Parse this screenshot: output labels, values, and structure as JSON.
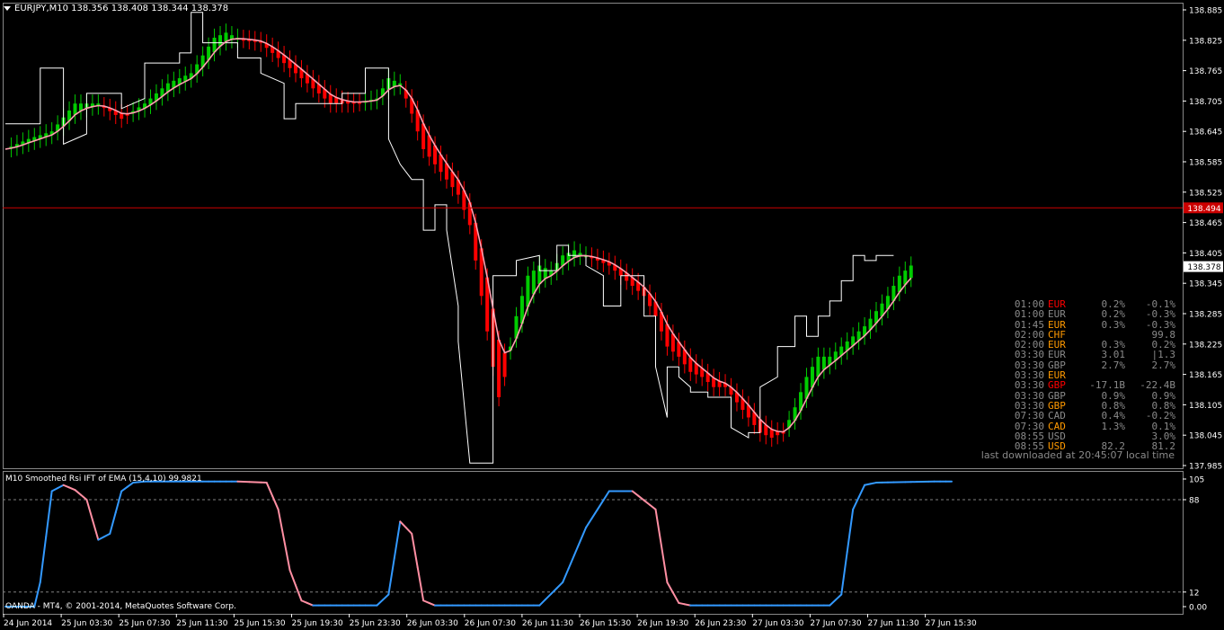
{
  "symbol_header": "EURJPY,M10  138.356 138.408 138.344 138.378",
  "indicator_title": "M10 Smoothed Rsi IFT of EMA (15,4,10) 99.9821",
  "copyright": "OANDA - MT4, © 2001-2014, MetaQuotes Software Corp.",
  "last_downloaded": "last downloaded at 20:45:07 local time",
  "colors": {
    "background": "#000000",
    "up_bar": "#00cc00",
    "down_bar": "#ff0000",
    "ema_line": "#ff9fb0",
    "channel_line": "#ffffff",
    "rsi_up": "#3399ff",
    "rsi_down": "#ff8fa3",
    "hline": "#cc0000",
    "grid": "#808080"
  },
  "news": [
    {
      "time": "01:00",
      "cur": "EUR",
      "color": "#ff0000",
      "a": "0.2%",
      "b": "-0.1%"
    },
    {
      "time": "01:00",
      "cur": "EUR",
      "color": "#8a8a8a",
      "a": "0.2%",
      "b": "-0.3%"
    },
    {
      "time": "01:45",
      "cur": "EUR",
      "color": "#ff9900",
      "a": "0.3%",
      "b": "-0.3%"
    },
    {
      "time": "02:00",
      "cur": "CHF",
      "color": "#ff9900",
      "a": "",
      "b": "99.8"
    },
    {
      "time": "02:00",
      "cur": "EUR",
      "color": "#ff9900",
      "a": "0.3%",
      "b": "0.2%"
    },
    {
      "time": "03:30",
      "cur": "EUR",
      "color": "#8a8a8a",
      "a": "3.01",
      "b": "|1.3"
    },
    {
      "time": "03:30",
      "cur": "GBP",
      "color": "#8a8a8a",
      "a": "2.7%",
      "b": "2.7%"
    },
    {
      "time": "03:30",
      "cur": "EUR",
      "color": "#ff9900",
      "a": "",
      "b": ""
    },
    {
      "time": "03:30",
      "cur": "GBP",
      "color": "#ff0000",
      "a": "-17.1B",
      "b": "-22.4B"
    },
    {
      "time": "03:30",
      "cur": "GBP",
      "color": "#8a8a8a",
      "a": "0.9%",
      "b": "0.9%"
    },
    {
      "time": "03:30",
      "cur": "GBP",
      "color": "#ff9900",
      "a": "0.8%",
      "b": "0.8%"
    },
    {
      "time": "07:30",
      "cur": "CAD",
      "color": "#8a8a8a",
      "a": "0.4%",
      "b": "-0.2%"
    },
    {
      "time": "07:30",
      "cur": "CAD",
      "color": "#ff9900",
      "a": "1.3%",
      "b": "0.1%"
    },
    {
      "time": "08:55",
      "cur": "USD",
      "color": "#8a8a8a",
      "a": "",
      "b": "3.0%"
    },
    {
      "time": "08:55",
      "cur": "USD",
      "color": "#ff9900",
      "a": "82.2",
      "b": "81.2"
    }
  ],
  "chart_data": [
    {
      "type": "candlestick",
      "title": "EURJPY,M10",
      "x_ticks": [
        "24 Jun 2014",
        "25 Jun 03:30",
        "25 Jun 07:30",
        "25 Jun 11:30",
        "25 Jun 15:30",
        "25 Jun 19:30",
        "25 Jun 23:30",
        "26 Jun 03:30",
        "26 Jun 07:30",
        "26 Jun 11:30",
        "26 Jun 15:30",
        "26 Jun 19:30",
        "26 Jun 23:30",
        "27 Jun 03:30",
        "27 Jun 07:30",
        "27 Jun 11:30",
        "27 Jun 15:30"
      ],
      "y_ticks": [
        "138.885",
        "138.825",
        "138.765",
        "138.705",
        "138.645",
        "138.585",
        "138.525",
        "138.465",
        "138.405",
        "138.345",
        "138.285",
        "138.225",
        "138.165",
        "138.105",
        "138.045",
        "137.985"
      ],
      "ylim": [
        137.985,
        138.885
      ],
      "grid": false,
      "hline": {
        "label": "138.494",
        "value": 138.494
      },
      "current_price": {
        "label": "138.378",
        "value": 138.378
      },
      "series": [
        {
          "name": "price",
          "anchors": [
            [
              0,
              138.61
            ],
            [
              4,
              138.63
            ],
            [
              8,
              138.645
            ],
            [
              12,
              138.7
            ],
            [
              16,
              138.7
            ],
            [
              20,
              138.67
            ],
            [
              24,
              138.7
            ],
            [
              28,
              138.74
            ],
            [
              32,
              138.76
            ],
            [
              36,
              138.83
            ],
            [
              38,
              138.84
            ],
            [
              40,
              138.83
            ],
            [
              44,
              138.82
            ],
            [
              48,
              138.78
            ],
            [
              52,
              138.74
            ],
            [
              56,
              138.7
            ],
            [
              60,
              138.7
            ],
            [
              64,
              138.71
            ],
            [
              66,
              138.75
            ],
            [
              68,
              138.74
            ],
            [
              70,
              138.68
            ],
            [
              72,
              138.61
            ],
            [
              74,
              138.58
            ],
            [
              76,
              138.55
            ],
            [
              78,
              138.52
            ],
            [
              80,
              138.46
            ],
            [
              82,
              138.32
            ],
            [
              84,
              138.18
            ],
            [
              85,
              138.12
            ],
            [
              86,
              138.16
            ],
            [
              88,
              138.28
            ],
            [
              90,
              138.36
            ],
            [
              92,
              138.38
            ],
            [
              94,
              138.37
            ],
            [
              96,
              138.4
            ],
            [
              98,
              138.41
            ],
            [
              100,
              138.4
            ],
            [
              102,
              138.39
            ],
            [
              104,
              138.38
            ],
            [
              106,
              138.36
            ],
            [
              108,
              138.34
            ],
            [
              110,
              138.32
            ],
            [
              112,
              138.28
            ],
            [
              114,
              138.22
            ],
            [
              116,
              138.2
            ],
            [
              118,
              138.17
            ],
            [
              120,
              138.16
            ],
            [
              122,
              138.14
            ],
            [
              124,
              138.14
            ],
            [
              126,
              138.11
            ],
            [
              128,
              138.08
            ],
            [
              130,
              138.05
            ],
            [
              132,
              138.04
            ],
            [
              134,
              138.05
            ],
            [
              136,
              138.1
            ],
            [
              138,
              138.16
            ],
            [
              140,
              138.2
            ],
            [
              142,
              138.2
            ],
            [
              144,
              138.22
            ],
            [
              146,
              138.24
            ],
            [
              148,
              138.26
            ],
            [
              150,
              138.29
            ],
            [
              152,
              138.32
            ],
            [
              154,
              138.36
            ],
            [
              156,
              138.38
            ]
          ]
        },
        {
          "name": "channel",
          "anchors": [
            [
              0,
              138.66
            ],
            [
              6,
              138.66
            ],
            [
              6,
              138.77
            ],
            [
              10,
              138.77
            ],
            [
              10,
              138.62
            ],
            [
              14,
              138.64
            ],
            [
              14,
              138.72
            ],
            [
              20,
              138.72
            ],
            [
              20,
              138.69
            ],
            [
              24,
              138.71
            ],
            [
              24,
              138.78
            ],
            [
              30,
              138.78
            ],
            [
              30,
              138.8
            ],
            [
              32,
              138.8
            ],
            [
              32,
              138.88
            ],
            [
              34,
              138.88
            ],
            [
              34,
              138.82
            ],
            [
              40,
              138.82
            ],
            [
              40,
              138.79
            ],
            [
              44,
              138.79
            ],
            [
              44,
              138.76
            ],
            [
              48,
              138.74
            ],
            [
              48,
              138.67
            ],
            [
              50,
              138.67
            ],
            [
              50,
              138.7
            ],
            [
              58,
              138.7
            ],
            [
              58,
              138.72
            ],
            [
              62,
              138.72
            ],
            [
              62,
              138.77
            ],
            [
              66,
              138.77
            ],
            [
              66,
              138.63
            ],
            [
              68,
              138.58
            ],
            [
              70,
              138.55
            ],
            [
              72,
              138.55
            ],
            [
              72,
              138.45
            ],
            [
              74,
              138.45
            ],
            [
              74,
              138.5
            ],
            [
              76,
              138.5
            ],
            [
              76,
              138.45
            ],
            [
              78,
              138.3
            ],
            [
              78,
              138.23
            ],
            [
              80,
              137.99
            ],
            [
              84,
              137.99
            ],
            [
              84,
              138.36
            ],
            [
              88,
              138.36
            ],
            [
              88,
              138.39
            ],
            [
              92,
              138.4
            ],
            [
              92,
              138.37
            ],
            [
              95,
              138.37
            ],
            [
              95,
              138.42
            ],
            [
              97,
              138.42
            ],
            [
              97,
              138.4
            ],
            [
              100,
              138.4
            ],
            [
              100,
              138.38
            ],
            [
              103,
              138.36
            ],
            [
              103,
              138.3
            ],
            [
              106,
              138.3
            ],
            [
              106,
              138.36
            ],
            [
              110,
              138.36
            ],
            [
              110,
              138.28
            ],
            [
              112,
              138.28
            ],
            [
              112,
              138.18
            ],
            [
              114,
              138.08
            ],
            [
              114,
              138.18
            ],
            [
              116,
              138.18
            ],
            [
              116,
              138.16
            ],
            [
              118,
              138.14
            ],
            [
              118,
              138.13
            ],
            [
              121,
              138.13
            ],
            [
              121,
              138.12
            ],
            [
              125,
              138.12
            ],
            [
              125,
              138.06
            ],
            [
              128,
              138.04
            ],
            [
              128,
              138.05
            ],
            [
              130,
              138.05
            ],
            [
              130,
              138.14
            ],
            [
              133,
              138.16
            ],
            [
              133,
              138.22
            ],
            [
              136,
              138.22
            ],
            [
              136,
              138.28
            ],
            [
              138,
              138.28
            ],
            [
              138,
              138.24
            ],
            [
              140,
              138.24
            ],
            [
              140,
              138.28
            ],
            [
              142,
              138.28
            ],
            [
              142,
              138.31
            ],
            [
              144,
              138.31
            ],
            [
              144,
              138.35
            ],
            [
              146,
              138.35
            ],
            [
              146,
              138.4
            ],
            [
              148,
              138.4
            ],
            [
              148,
              138.39
            ],
            [
              150,
              138.39
            ],
            [
              150,
              138.4
            ],
            [
              153,
              138.4
            ]
          ]
        }
      ]
    },
    {
      "type": "line",
      "title": "M10 Smoothed Rsi IFT of EMA (15,4,10)",
      "y_ticks": [
        "105",
        "88",
        "12",
        "0.00"
      ],
      "ylim": [
        0,
        105
      ],
      "levels": [
        88,
        12
      ],
      "series": [
        {
          "name": "rsi",
          "anchors": [
            [
              0,
              0
            ],
            [
              5,
              0
            ],
            [
              6,
              20
            ],
            [
              8,
              95
            ],
            [
              10,
              100
            ],
            [
              12,
              96
            ],
            [
              14,
              88
            ],
            [
              16,
              55
            ],
            [
              18,
              60
            ],
            [
              20,
              95
            ],
            [
              22,
              102
            ],
            [
              24,
              103
            ],
            [
              40,
              103
            ],
            [
              45,
              102
            ],
            [
              47,
              80
            ],
            [
              49,
              30
            ],
            [
              51,
              5
            ],
            [
              53,
              1
            ],
            [
              64,
              1
            ],
            [
              66,
              10
            ],
            [
              68,
              70
            ],
            [
              70,
              60
            ],
            [
              72,
              5
            ],
            [
              74,
              1
            ],
            [
              92,
              1
            ],
            [
              96,
              20
            ],
            [
              100,
              65
            ],
            [
              104,
              95
            ],
            [
              108,
              95
            ],
            [
              112,
              80
            ],
            [
              114,
              20
            ],
            [
              116,
              3
            ],
            [
              118,
              1
            ],
            [
              142,
              1
            ],
            [
              144,
              10
            ],
            [
              146,
              80
            ],
            [
              148,
              100
            ],
            [
              150,
              102
            ],
            [
              160,
              103
            ],
            [
              163,
              103
            ]
          ]
        }
      ]
    }
  ]
}
